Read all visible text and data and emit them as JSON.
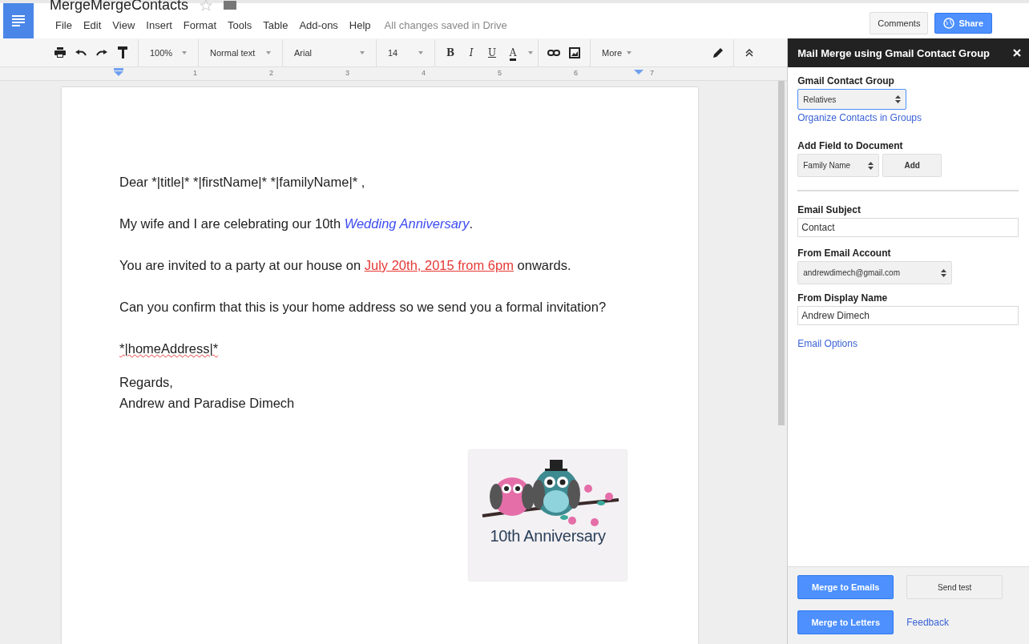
{
  "document": {
    "title": "MergeMergeContacts"
  },
  "menu": [
    "File",
    "Edit",
    "View",
    "Insert",
    "Format",
    "Tools",
    "Table",
    "Add-ons",
    "Help"
  ],
  "save_status": "All changes saved in Drive",
  "header_buttons": {
    "comments": "Comments",
    "share": "Share"
  },
  "toolbar": {
    "zoom": "100%",
    "style": "Normal text",
    "font": "Arial",
    "size": "14",
    "bold": "B",
    "italic": "I",
    "underline": "U",
    "text_color": "A",
    "more": "More"
  },
  "ruler": [
    "1",
    "2",
    "3",
    "4",
    "5",
    "6",
    "7"
  ],
  "paragraphs": [
    {
      "segments": [
        {
          "text": "Dear *|title|* *|firstName|* *|familyName|* ,",
          "kind": "plain"
        }
      ]
    },
    {
      "segments": [
        {
          "text": "My wife and I are celebrating our 10th ",
          "kind": "plain"
        },
        {
          "text": "Wedding Anniversary",
          "kind": "emphasis"
        },
        {
          "text": ".",
          "kind": "plain"
        }
      ]
    },
    {
      "segments": [
        {
          "text": "You are invited to a party at our house on ",
          "kind": "plain"
        },
        {
          "text": "July 20th, 2015 from 6pm",
          "kind": "date"
        },
        {
          "text": " onwards.",
          "kind": "plain"
        }
      ]
    },
    {
      "segments": [
        {
          "text": "Can you confirm that this is your home address so we send you a formal invitation?",
          "kind": "plain"
        }
      ]
    },
    {
      "segments": [
        {
          "text": "*|homeAddress|*",
          "kind": "misspelled"
        }
      ]
    }
  ],
  "closing": [
    "Regards,",
    "Andrew and Paradise Dimech"
  ],
  "image": {
    "caption": "10th Anniversary"
  },
  "sidebar": {
    "title": "Mail Merge using Gmail Contact Group",
    "contact_group": {
      "label": "Gmail Contact Group",
      "value": "Relatives"
    },
    "organize_link": "Organize Contacts in Groups",
    "add_field": {
      "label": "Add Field to Document",
      "value": "Family Name",
      "button": "Add"
    },
    "email_subject": {
      "label": "Email Subject",
      "value": "Contact"
    },
    "from_account": {
      "label": "From Email Account",
      "value": "andrewdimech@gmail.com"
    },
    "display_name": {
      "label": "From Display Name",
      "value": "Andrew Dimech"
    },
    "options_link": "Email Options",
    "merge_emails": "Merge to Emails",
    "send_test": "Send test",
    "merge_letters": "Merge to Letters",
    "feedback": "Feedback"
  }
}
